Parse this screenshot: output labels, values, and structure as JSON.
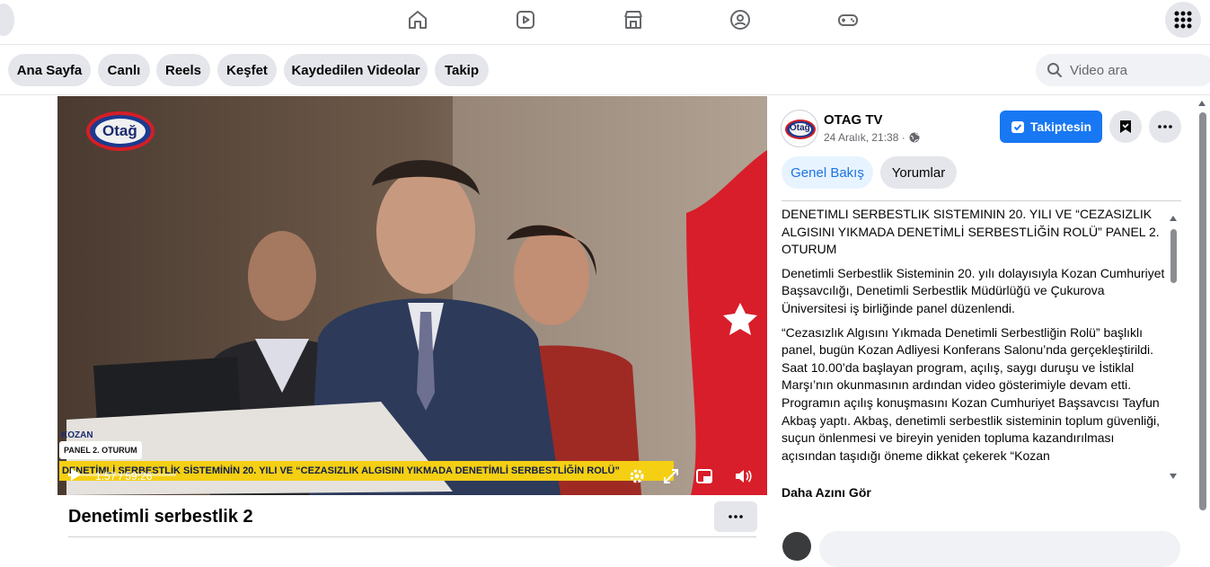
{
  "subnav": {
    "pills": [
      "Ana Sayfa",
      "Canlı",
      "Reels",
      "Keşfet",
      "Kaydedilen Videolar",
      "Takip"
    ],
    "search_placeholder": "Video ara"
  },
  "video": {
    "logo_text": "Otağ",
    "chyron_tag": "PANEL 2. OTURUM",
    "chyron_text": "DENETİMLİ SERBESTLİK SİSTEMİNİN 20. YILI VE “CEZASIZLIK ALGISINI YIKMADA DENETİMLİ SERBESTLİĞİN ROLÜ”",
    "time": "1:57 / 59:26",
    "progress_fraction": 0.033,
    "side_text": "KOZAN"
  },
  "post": {
    "title": "Denetimli serbestlik 2"
  },
  "page": {
    "name": "OTAG TV",
    "date": "24 Aralık, 21:38 ·",
    "follow_label": "Takiptesin",
    "avatar_text": "Otağ"
  },
  "tabs": [
    "Genel Bakış",
    "Yorumlar"
  ],
  "description": {
    "heading": "DENETİMLİ SERBESTLİK SİSTEMİNİN 20. YILI VE “CEZASIZLIK ALGISINI YIKMADA DENETİMLİ SERBESTLİĞİN ROLÜ” PANEL 2. OTURUM",
    "p1": "Denetimli Serbestlik Sisteminin 20. yılı dolayısıyla Kozan Cumhuriyet Başsavcılığı, Denetimli Serbestlik Müdürlüğü ve Çukurova Üniversitesi iş birliğinde panel düzenlendi.",
    "p2": "“Cezasızlık Algısını Yıkmada Denetimli Serbestliğin Rolü” başlıklı panel, bugün Kozan Adliyesi Konferans Salonu’nda gerçekleştirildi.",
    "p3": "Saat 10.00’da başlayan program, açılış, saygı duruşu ve İstiklal Marşı’nın okunmasının ardından video gösterimiyle devam etti. Programın açılış konuşmasını Kozan Cumhuriyet Başsavcısı Tayfun Akbaş yaptı. Akbaş, denetimli serbestlik sisteminin toplum güvenliği, suçun önlenmesi ve bireyin yeniden topluma kazandırılması açısından taşıdığı öneme dikkat çekerek “Kozan",
    "see_more": "Daha Azını Gör"
  },
  "colors": {
    "brand": "#1877f2",
    "chyron": "#f4cf14",
    "flag": "#d81e2a"
  }
}
